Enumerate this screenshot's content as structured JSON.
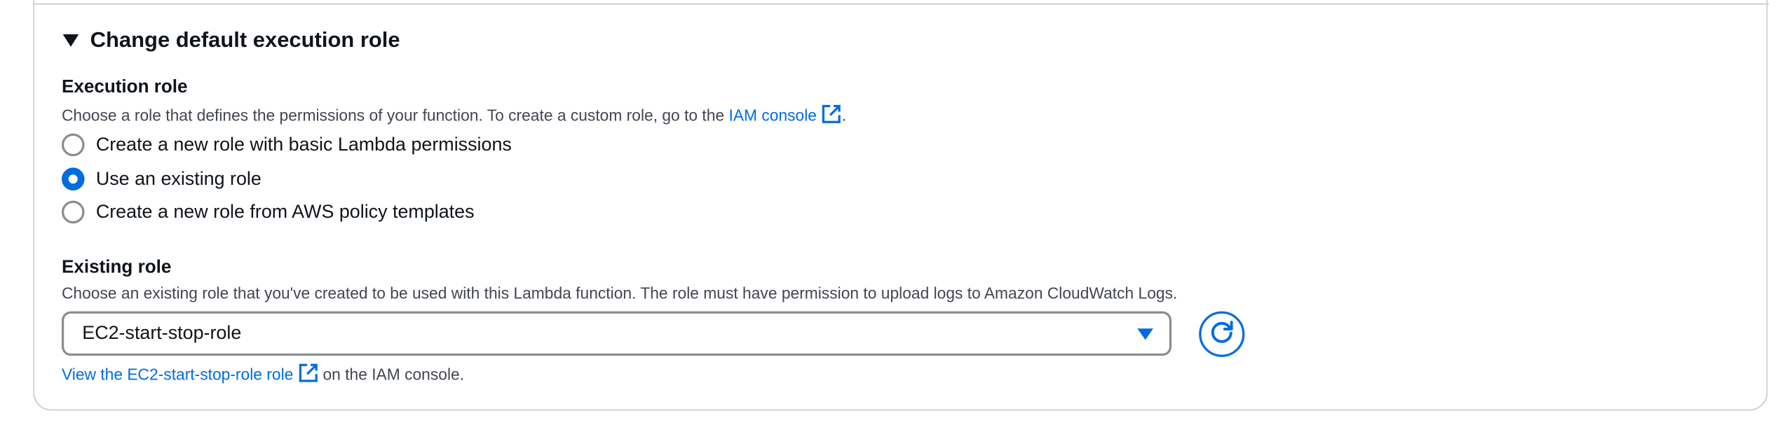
{
  "section": {
    "expander_title": "Change default execution role",
    "expanded": true
  },
  "execution_role": {
    "label": "Execution role",
    "description_prefix": "Choose a role that defines the permissions of your function. To create a custom role, go to the ",
    "iam_console_link": "IAM console",
    "description_suffix": ".",
    "options": [
      {
        "label": "Create a new role with basic Lambda permissions",
        "selected": false
      },
      {
        "label": "Use an existing role",
        "selected": true
      },
      {
        "label": "Create a new role from AWS policy templates",
        "selected": false
      }
    ]
  },
  "existing_role": {
    "label": "Existing role",
    "description": "Choose an existing role that you've created to be used with this Lambda function. The role must have permission to upload logs to Amazon CloudWatch Logs.",
    "selected_value": "EC2-start-stop-role",
    "view_link": "View the EC2-start-stop-role role",
    "view_suffix": " on the IAM console."
  },
  "colors": {
    "link": "#006ce0",
    "radio_selected": "#006ce0",
    "border": "#8c8c94",
    "text": "#0f141a",
    "secondary_text": "#424650"
  },
  "icons": {
    "expander": "caret-down-icon",
    "external": "external-link-icon",
    "dropdown": "dropdown-arrow-icon",
    "refresh": "refresh-icon"
  }
}
